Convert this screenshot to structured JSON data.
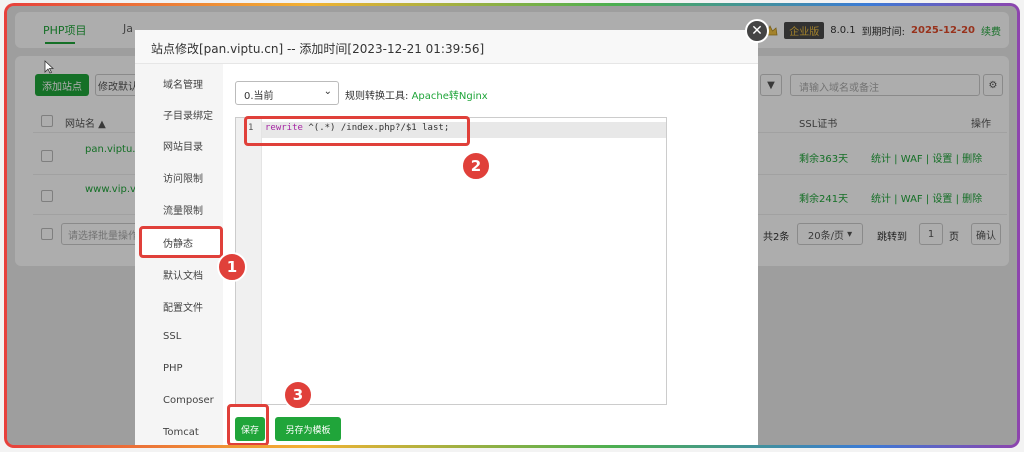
{
  "background": {
    "tabs": [
      {
        "label": "PHP项目",
        "active": true
      },
      {
        "label": "Ja",
        "active": false
      }
    ],
    "version": {
      "edition_label": "企业版",
      "version": "8.0.1",
      "expire_label": "到期时间:",
      "expire_date": "2025-12-20",
      "renew_label": "续费"
    },
    "add_site_label": "添加站点",
    "edit_default_label": "修改默认",
    "search_placeholder": "请输入域名或备注",
    "site_name_header": "网站名 ▲",
    "ssl_header": "SSL证书",
    "ops_header": "操作",
    "rows": [
      {
        "name": "pan.viptu.cn",
        "ssl": "剩余363天",
        "ops": "统计 | WAF | 设置 | 删除"
      },
      {
        "name": "www.vip.viptu.cn",
        "ssl": "剩余241天",
        "ops": "统计 | WAF | 设置 | 删除"
      }
    ],
    "batch_placeholder": "请选择批量操作",
    "pagination": {
      "total": "共2条",
      "per_page": "20条/页",
      "jump_label": "跳转到",
      "page": "1",
      "page_unit": "页",
      "confirm": "确认"
    }
  },
  "modal": {
    "title": "站点修改[pan.viptu.cn] -- 添加时间[2023-12-21 01:39:56]",
    "side_items": [
      "域名管理",
      "子目录绑定",
      "网站目录",
      "访问限制",
      "流量限制",
      "伪静态",
      "默认文档",
      "配置文件",
      "SSL",
      "PHP",
      "Composer",
      "Tomcat"
    ],
    "active_side_item": "伪静态",
    "select_value": "0.当前",
    "rule_tool_label": "规则转换工具:",
    "rule_tool_link": "Apache转Nginx",
    "editor": {
      "line_number": "1",
      "code_keyword": "rewrite",
      "code_rest": " ^(.*) /index.php?/$1 last;"
    },
    "save_label": "保存",
    "save_template_label": "另存为模板"
  },
  "annotations": [
    "1",
    "2",
    "3"
  ],
  "colors": {
    "accent": "#20a53a",
    "annotation": "#e0403a"
  }
}
